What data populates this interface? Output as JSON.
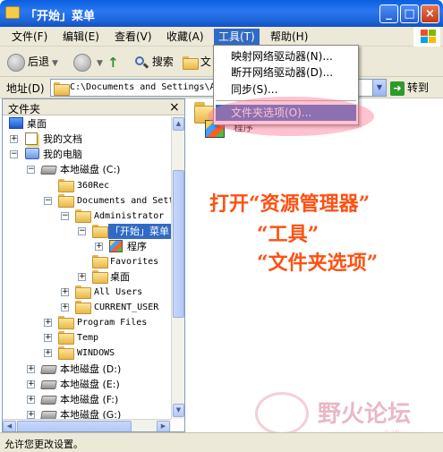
{
  "window": {
    "title": "「开始」菜单"
  },
  "menubar": {
    "items": [
      "文件(F)",
      "编辑(E)",
      "查看(V)",
      "收藏(A)",
      "工具(T)",
      "帮助(H)"
    ]
  },
  "toolbar": {
    "back": "后退",
    "search": "搜索",
    "folders_partial": "文"
  },
  "address": {
    "label": "地址(D)",
    "value": "C:\\Documents and Settings\\A",
    "go": "转到"
  },
  "pane": {
    "title": "文件夹",
    "close": "×",
    "tree": [
      "桌面",
      "我的文档",
      "我的电脑",
      "本地磁盘 (C:)",
      "360Rec",
      "Documents and Setti",
      "Administrator",
      "「开始」菜单",
      "程序",
      "Favorites",
      "桌面",
      "All Users",
      "CURRENT_USER",
      "Program Files",
      "Temp",
      "WINDOWS",
      "本地磁盘 (D:)",
      "本地磁盘 (E:)",
      "本地磁盘 (F:)",
      "本地磁盘 (G:)"
    ]
  },
  "content": {
    "program_label": "程序",
    "callouts": [
      "打开“资源管理器”",
      "“工具”",
      "“文件夹选项”"
    ],
    "watermark_text": "野火论坛",
    "watermark_url": "www.proewildfire.cn"
  },
  "tools_menu": {
    "items": [
      "映射网络驱动器(N)...",
      "断开网络驱动器(D)...",
      "同步(S)...",
      "文件夹选项(O)..."
    ]
  },
  "status": {
    "text": "允许您更改设置。"
  },
  "colors": {
    "menu_highlight": "#316ac5",
    "callout": "#ff5010"
  }
}
